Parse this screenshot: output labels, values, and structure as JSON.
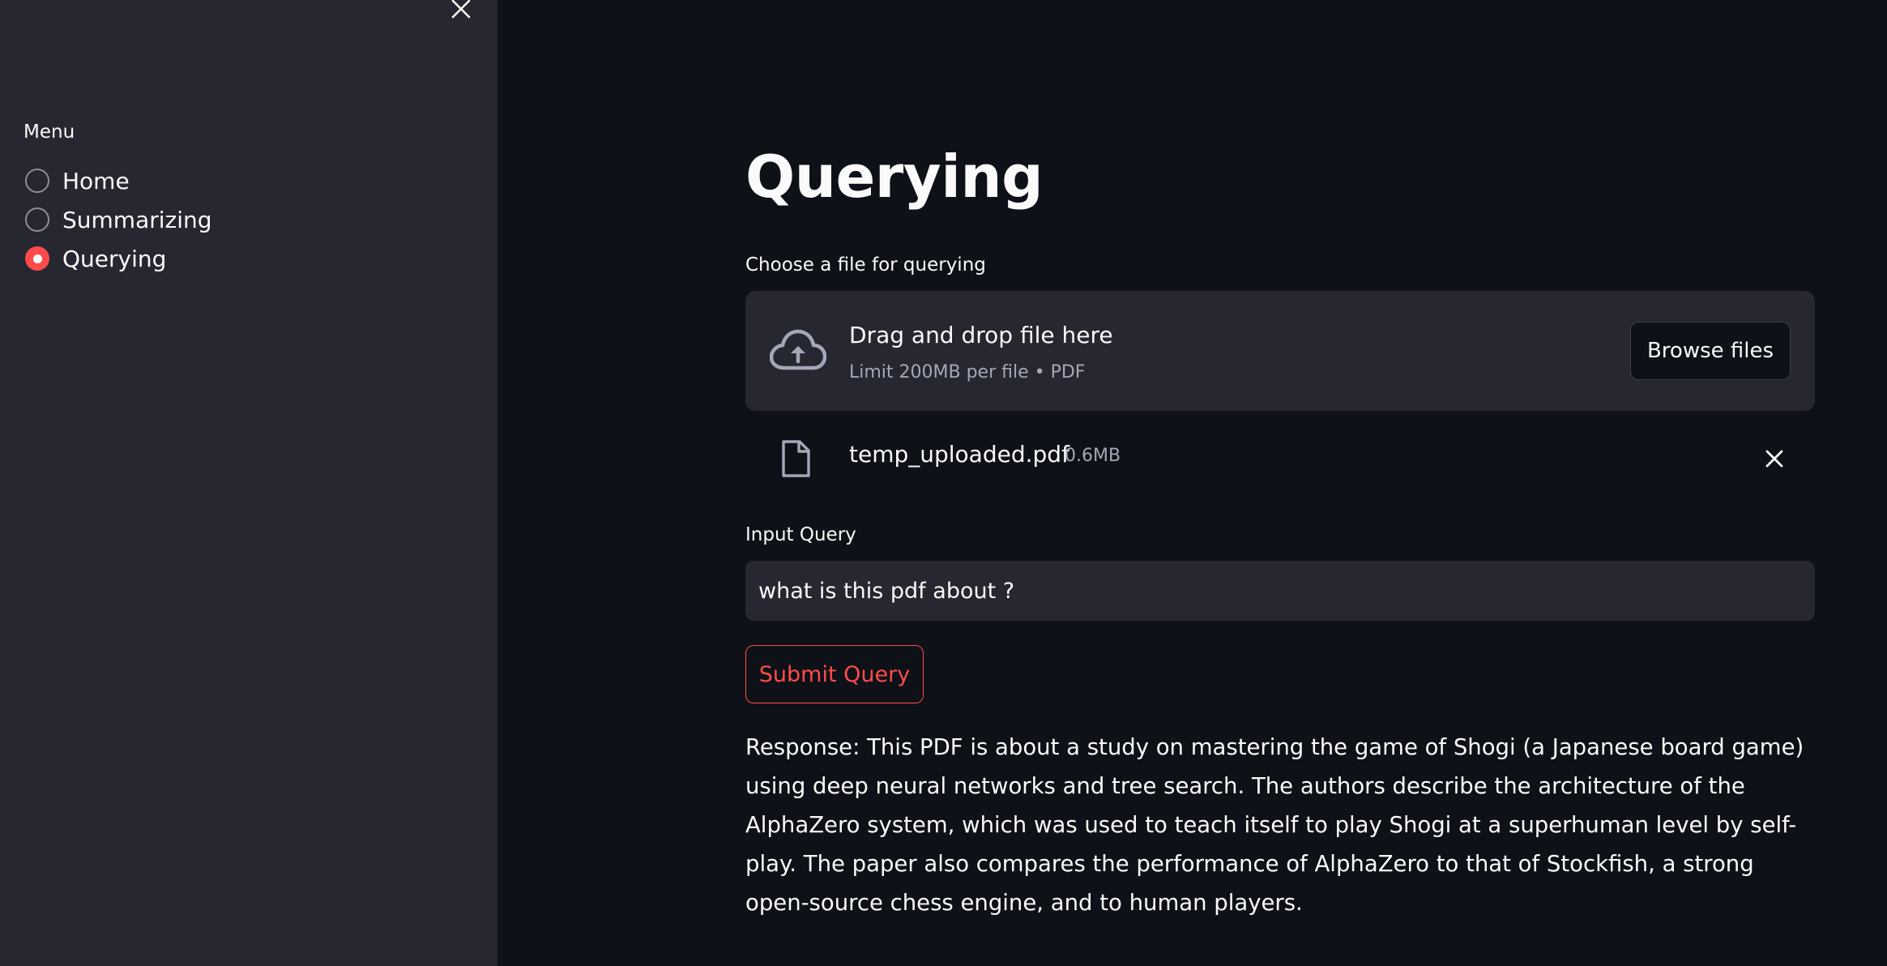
{
  "sidebar": {
    "menu_label": "Menu",
    "items": [
      {
        "label": "Home",
        "checked": false
      },
      {
        "label": "Summarizing",
        "checked": false
      },
      {
        "label": "Querying",
        "checked": true
      }
    ]
  },
  "main": {
    "title": "Querying",
    "uploader": {
      "label": "Choose a file for querying",
      "drop_title": "Drag and drop file here",
      "drop_limit": "Limit 200MB per file • PDF",
      "browse_label": "Browse files"
    },
    "uploaded_file": {
      "name": "temp_uploaded.pdf",
      "size": "0.6MB"
    },
    "query": {
      "label": "Input Query",
      "value": "what is this pdf about ?"
    },
    "submit_label": "Submit Query",
    "response": "Response: This PDF is about a study on mastering the game of Shogi (a Japanese board game) using deep neural networks and tree search. The authors describe the architecture of the AlphaZero system, which was used to teach itself to play Shogi at a superhuman level by self-play. The paper also compares the performance of AlphaZero to that of Stockfish, a strong open-source chess engine, and to human players."
  },
  "colors": {
    "background": "#0e1117",
    "sidebar": "#262730",
    "accent": "#ff4b4b",
    "text": "#fafafa",
    "muted": "#a3a8b8"
  },
  "icons": [
    "close-icon",
    "cloud-upload-icon",
    "file-icon",
    "remove-icon"
  ]
}
